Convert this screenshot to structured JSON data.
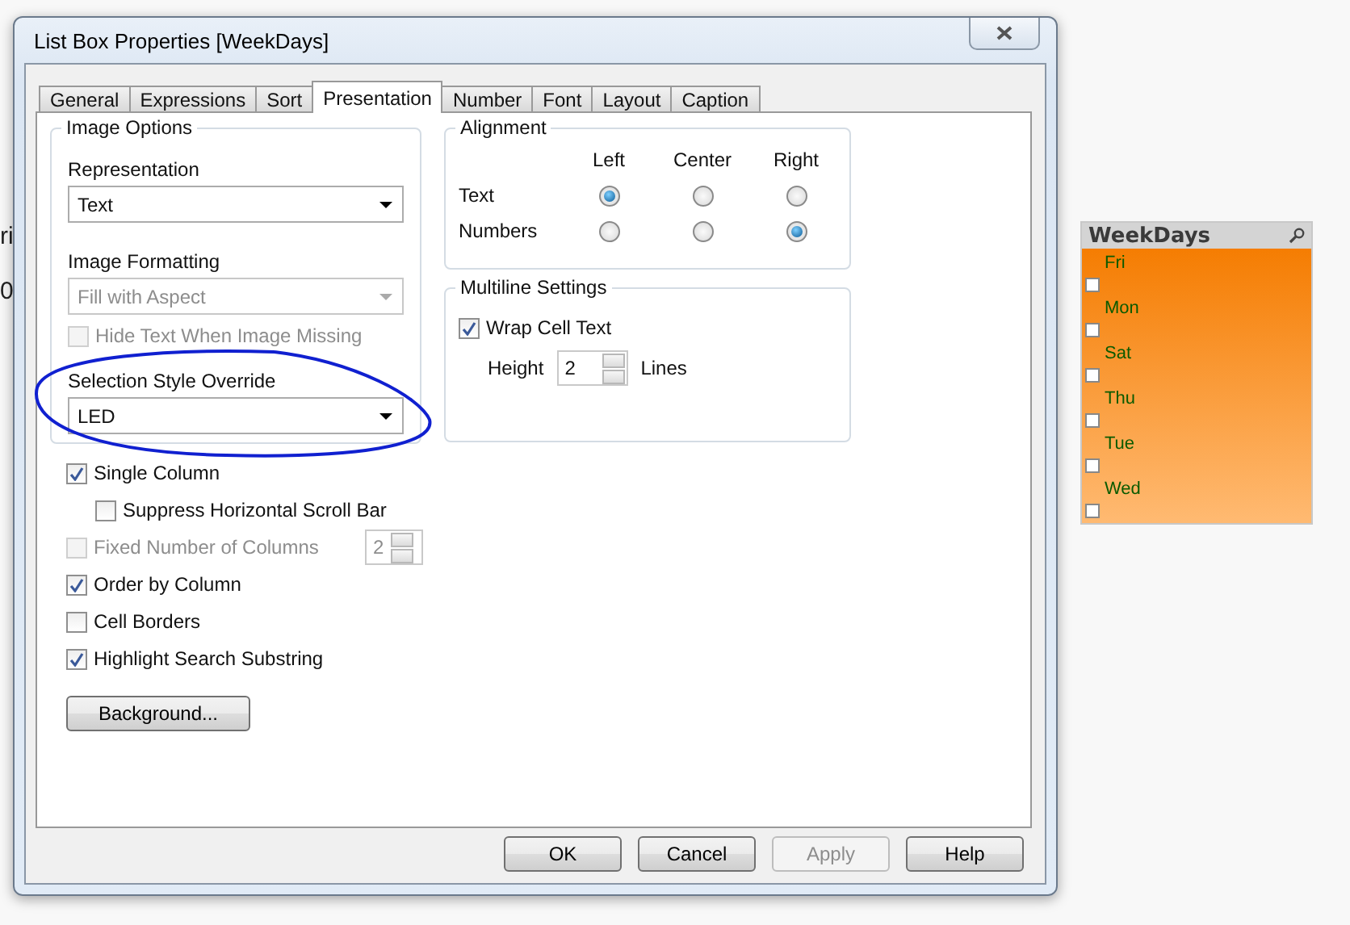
{
  "background_fragments": [
    "ri",
    "0"
  ],
  "dialog": {
    "title": "List Box Properties [WeekDays]",
    "tabs": [
      {
        "label": "General",
        "selected": false
      },
      {
        "label": "Expressions",
        "selected": false
      },
      {
        "label": "Sort",
        "selected": false
      },
      {
        "label": "Presentation",
        "selected": true
      },
      {
        "label": "Number",
        "selected": false
      },
      {
        "label": "Font",
        "selected": false
      },
      {
        "label": "Layout",
        "selected": false
      },
      {
        "label": "Caption",
        "selected": false
      }
    ],
    "image_options": {
      "title": "Image Options",
      "representation": {
        "label": "Representation",
        "value": "Text",
        "disabled": false
      },
      "image_formatting": {
        "label": "Image Formatting",
        "value": "Fill with Aspect",
        "disabled": true
      },
      "hide_text": {
        "label": "Hide Text When Image Missing",
        "checked": false,
        "disabled": true
      },
      "selection_style": {
        "label": "Selection Style Override",
        "value": "LED",
        "disabled": false
      }
    },
    "options": [
      {
        "label": "Single Column",
        "checked": true,
        "disabled": false,
        "children": [
          {
            "label": "Suppress Horizontal Scroll Bar",
            "checked": false,
            "disabled": false
          }
        ]
      },
      {
        "label": "Fixed Number of Columns",
        "checked": false,
        "disabled": true,
        "spinner": "2"
      },
      {
        "label": "Order by Column",
        "checked": true,
        "disabled": false
      },
      {
        "label": "Cell Borders",
        "checked": false,
        "disabled": false
      },
      {
        "label": "Highlight Search Substring",
        "checked": true,
        "disabled": false
      }
    ],
    "background_button": "Background...",
    "alignment": {
      "title": "Alignment",
      "columns": [
        "Left",
        "Center",
        "Right"
      ],
      "rows": [
        {
          "label": "Text",
          "options": [
            {
              "selected": true
            },
            {
              "selected": false
            },
            {
              "selected": false
            }
          ]
        },
        {
          "label": "Numbers",
          "options": [
            {
              "selected": false
            },
            {
              "selected": false
            },
            {
              "selected": true
            }
          ]
        }
      ]
    },
    "multiline": {
      "title": "Multiline Settings",
      "wrap": {
        "label": "Wrap Cell Text",
        "checked": true
      },
      "height_label": "Height",
      "height_value": "2",
      "lines_label": "Lines"
    },
    "buttons": [
      {
        "label": "OK",
        "disabled": false
      },
      {
        "label": "Cancel",
        "disabled": false
      },
      {
        "label": "Apply",
        "disabled": true
      },
      {
        "label": "Help",
        "disabled": false
      }
    ]
  },
  "listbox": {
    "title": "WeekDays",
    "items": [
      {
        "label": "Fri",
        "checked": false
      },
      {
        "label": "Mon",
        "checked": false
      },
      {
        "label": "Sat",
        "checked": false
      },
      {
        "label": "Thu",
        "checked": false
      },
      {
        "label": "Tue",
        "checked": false
      },
      {
        "label": "Wed",
        "checked": false
      }
    ]
  }
}
